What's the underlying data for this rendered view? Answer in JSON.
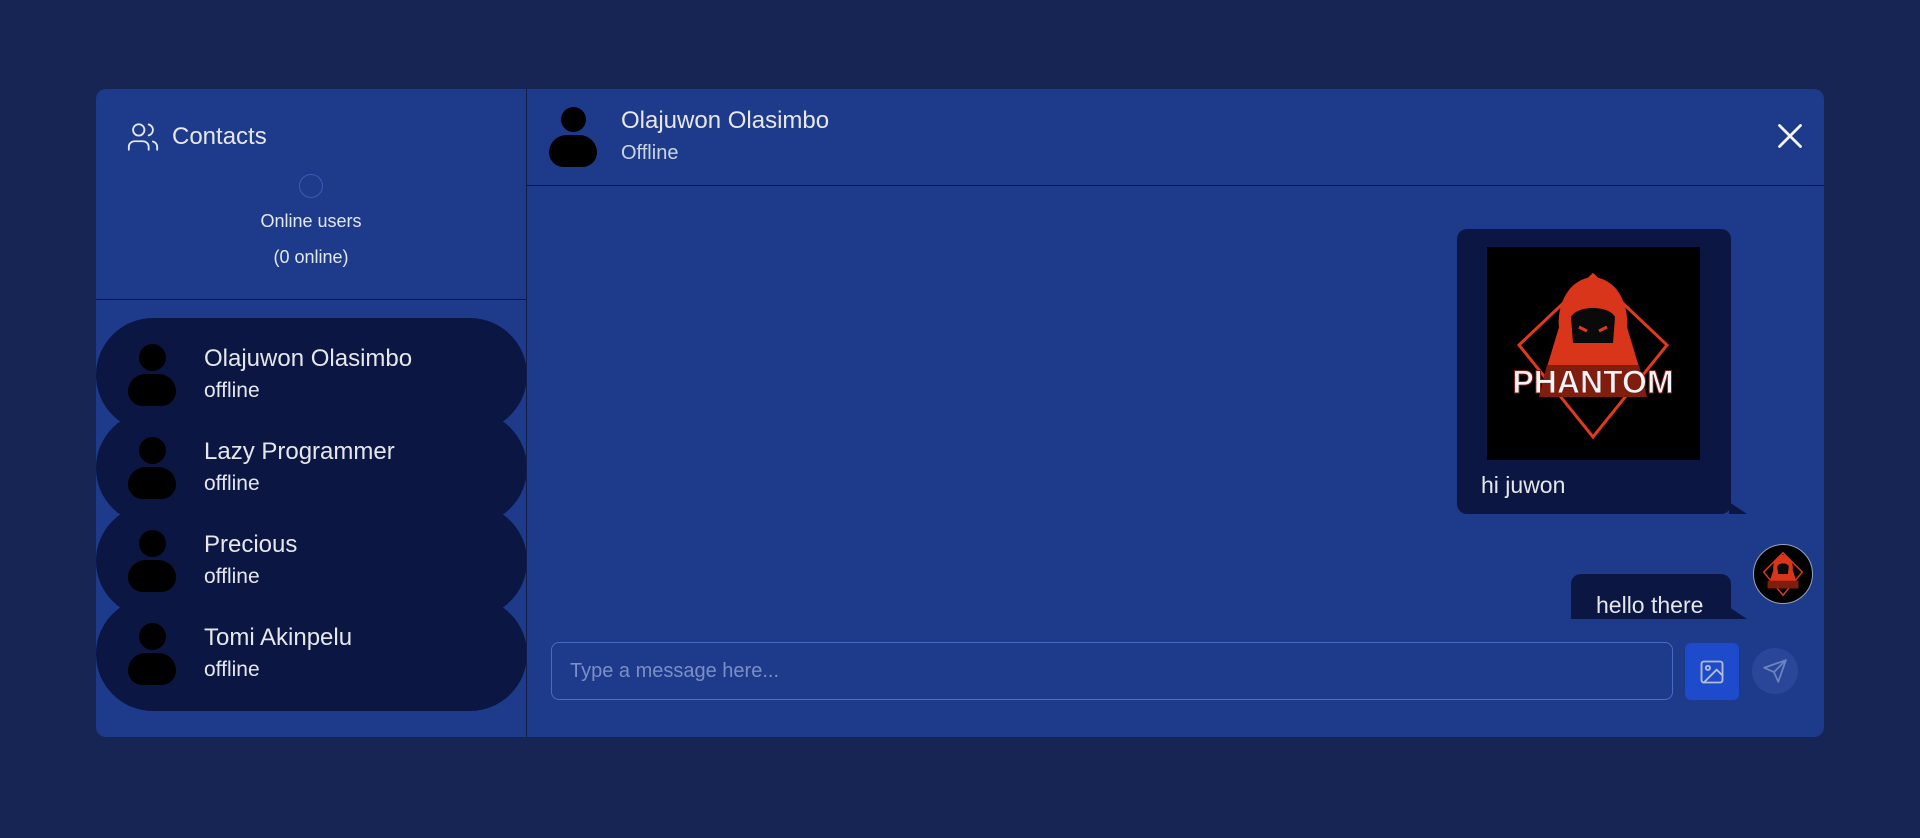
{
  "sidebar": {
    "title": "Contacts",
    "title_icon": "users-icon",
    "online_label": "Online users",
    "online_count": "(0 online)",
    "contacts": [
      {
        "name": "Olajuwon Olasimbo",
        "status": "offline"
      },
      {
        "name": "Lazy Programmer",
        "status": "offline"
      },
      {
        "name": "Precious",
        "status": "offline"
      },
      {
        "name": "Tomi Akinpelu",
        "status": "offline"
      }
    ]
  },
  "chat": {
    "name": "Olajuwon Olasimbo",
    "status": "Offline",
    "close_icon": "close-icon",
    "messages": [
      {
        "type": "image",
        "image_logo_text": "PHANTOM",
        "text": "hi juwon"
      },
      {
        "type": "text",
        "text": "hello there"
      }
    ],
    "composer": {
      "placeholder": "Type a message here...",
      "image_icon": "image-icon",
      "send_icon": "send-icon"
    }
  },
  "colors": {
    "page_bg": "#172554",
    "panel_bg": "#1e3a8a",
    "bubble_bg": "#0b1642",
    "accent": "#1d4ed8"
  }
}
